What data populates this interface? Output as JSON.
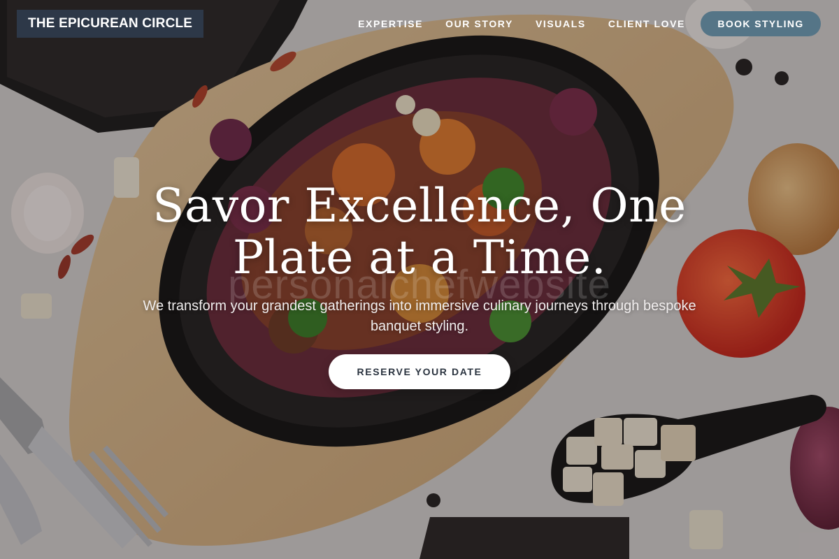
{
  "brand": {
    "name": "THE EPICUREAN CIRCLE"
  },
  "nav": {
    "links": [
      "EXPERTISE",
      "OUR STORY",
      "VISUALS",
      "CLIENT LOVE"
    ],
    "cta_label": "BOOK STYLING"
  },
  "hero": {
    "headline_line1": "Savor Excellence, One",
    "headline_line2": "Plate at a Time.",
    "watermark": "personalchefwebsite",
    "subtitle": "We transform your grandest gatherings into immersive culinary journeys through bespoke banquet styling.",
    "cta_label": "RESERVE YOUR DATE"
  },
  "colors": {
    "logo_bg": "#2d3848",
    "nav_cta_bg": "#557587",
    "hero_cta_bg": "#ffffff",
    "hero_cta_text": "#2b3440"
  },
  "icons": [
    "food-photo-background"
  ]
}
